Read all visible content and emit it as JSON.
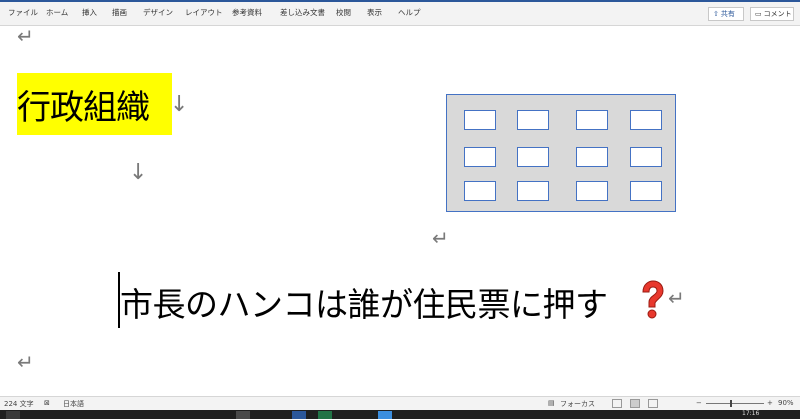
{
  "ribbon": {
    "tabs": [
      "ファイル",
      "ホーム",
      "挿入",
      "描画",
      "デザイン",
      "レイアウト",
      "参考資料",
      "差し込み文書",
      "校閲",
      "表示",
      "ヘルプ"
    ],
    "share_label": "共有",
    "comment_label": "コメント"
  },
  "document": {
    "paragraph_mark": "↵",
    "down_arrow": "↓",
    "heading_text": "行政組織",
    "highlight_color": "#ffff00",
    "main_text": "市長のハンコは誰が住民票に押す",
    "question_icon": "red-question-mark-icon"
  },
  "statusbar": {
    "word_count": "224 文字",
    "language": "日本語",
    "focus_label": "フォーカス",
    "zoom_minus": "−",
    "zoom_plus": "+",
    "zoom_level": "90%"
  },
  "taskbar": {
    "time": "17:16"
  },
  "colors": {
    "accent": "#2b579a",
    "panel_border": "#4472c4",
    "panel_fill": "#d9d9d9"
  }
}
